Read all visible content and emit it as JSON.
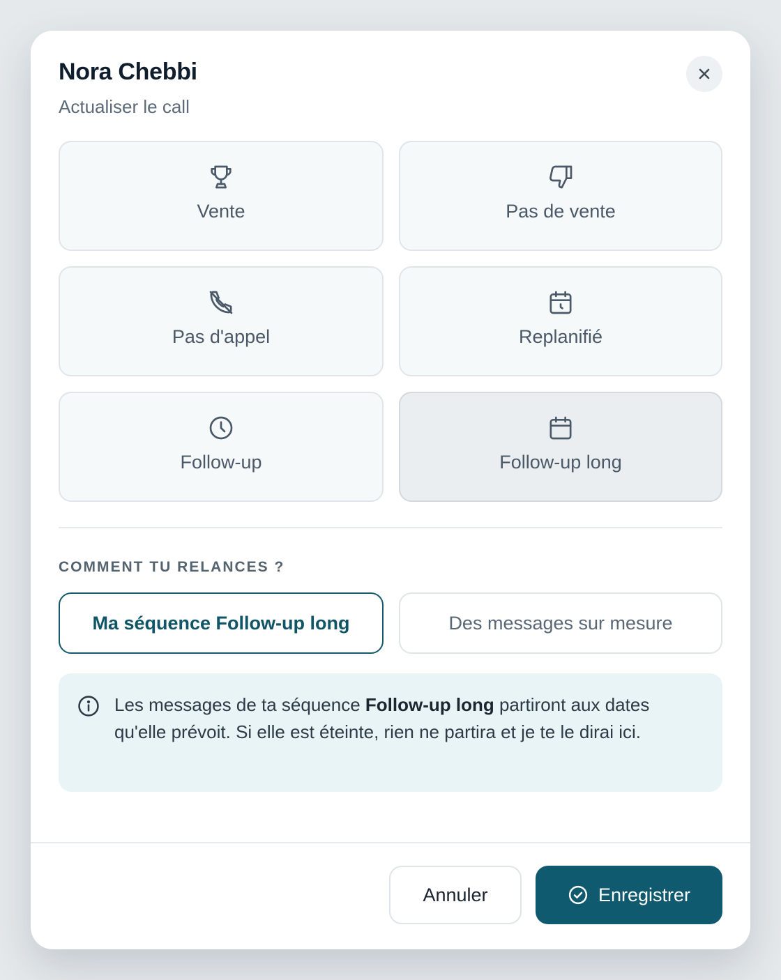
{
  "modal": {
    "title": "Nora Chebbi",
    "subtitle": "Actualiser le call"
  },
  "outcomes": [
    {
      "label": "Vente",
      "icon": "trophy-icon",
      "selected": false
    },
    {
      "label": "Pas de vente",
      "icon": "thumbs-down-icon",
      "selected": false
    },
    {
      "label": "Pas d'appel",
      "icon": "phone-off-icon",
      "selected": false
    },
    {
      "label": "Replanifié",
      "icon": "calendar-clock-icon",
      "selected": false
    },
    {
      "label": "Follow-up",
      "icon": "clock-icon",
      "selected": false
    },
    {
      "label": "Follow-up long",
      "icon": "calendar-icon",
      "selected": true
    }
  ],
  "followup": {
    "section_label": "COMMENT TU RELANCES ?",
    "options": [
      {
        "label": "Ma séquence Follow-up long",
        "selected": true
      },
      {
        "label": "Des messages sur mesure",
        "selected": false
      }
    ],
    "info": {
      "before": "Les messages de ta séquence ",
      "bold": "Follow-up long",
      "after": " partiront aux dates qu'elle prévoit. Si elle est éteinte, rien ne partira et je te le dirai ici."
    }
  },
  "footer": {
    "cancel_label": "Annuler",
    "save_label": "Enregistrer"
  },
  "colors": {
    "primary": "#0f5a6e",
    "option_bg": "#f6f9fa",
    "option_selected_bg": "#ebeef1",
    "info_bg": "#e9f4f6"
  }
}
